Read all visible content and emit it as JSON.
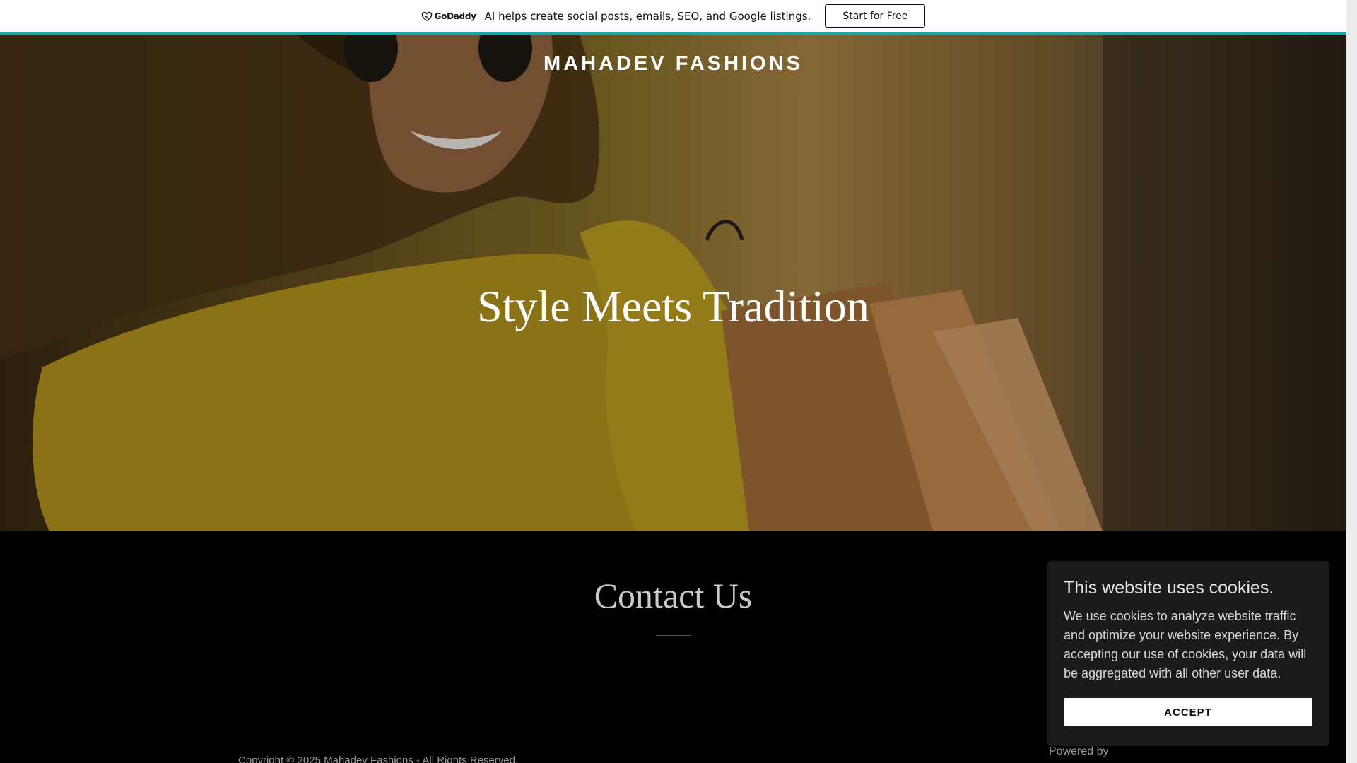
{
  "promo": {
    "logo_text": "GoDaddy",
    "message": "AI helps create social posts, emails, SEO, and Google listings.",
    "cta_label": "Start for Free",
    "stripe_color": "#1fa3a6"
  },
  "hero": {
    "site_title": "MAHADEV FASHIONS",
    "tagline": "Style Meets Tradition"
  },
  "contact": {
    "heading": "Contact Us"
  },
  "footer": {
    "copyright": "Copyright © 2025 Mahadev Fashions - All Rights Reserved.",
    "powered_by": "Powered by"
  },
  "cookie_banner": {
    "title": "This website uses cookies.",
    "body": "We use cookies to analyze website traffic and optimize your website experience. By accepting our use of cookies, your data will be aggregated with all other user data.",
    "accept_label": "ACCEPT"
  }
}
